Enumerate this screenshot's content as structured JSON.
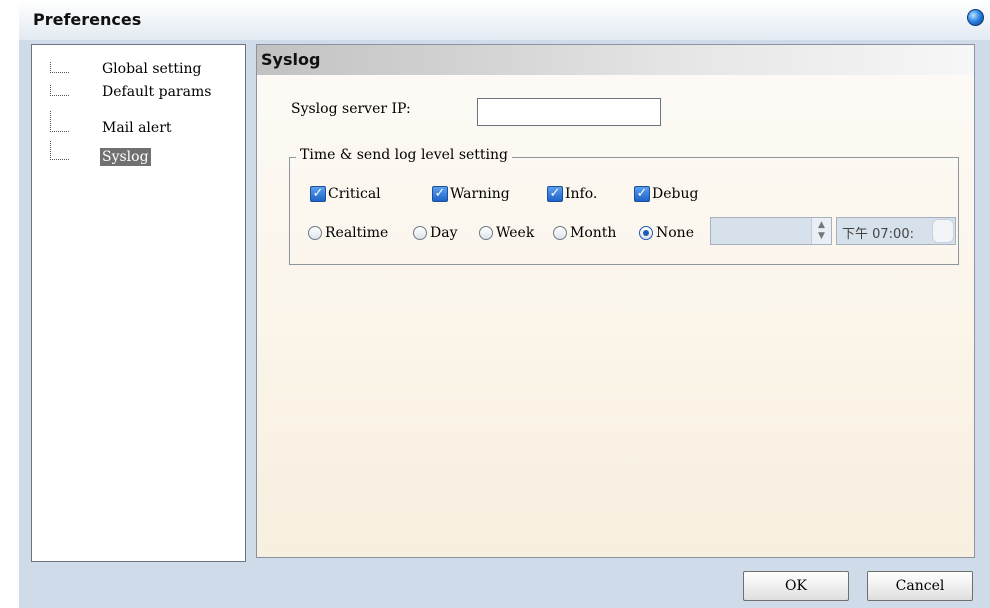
{
  "window": {
    "title": "Preferences"
  },
  "tree": {
    "items": [
      {
        "label": "Global setting",
        "selected": false
      },
      {
        "label": "Default params",
        "selected": false
      },
      {
        "label": "Mail alert",
        "selected": false
      },
      {
        "label": "Syslog",
        "selected": true
      }
    ]
  },
  "syslog": {
    "section_title": "Syslog",
    "server_ip_label": "Syslog server IP:",
    "server_ip_value": "",
    "group_legend": "Time & send log level setting",
    "levels": [
      {
        "label": "Critical",
        "checked": true
      },
      {
        "label": "Warning",
        "checked": true
      },
      {
        "label": "Info.",
        "checked": true
      },
      {
        "label": "Debug",
        "checked": true
      }
    ],
    "schedule": [
      {
        "label": "Realtime",
        "checked": false
      },
      {
        "label": "Day",
        "checked": false
      },
      {
        "label": "Week",
        "checked": false
      },
      {
        "label": "Month",
        "checked": false
      },
      {
        "label": "None",
        "checked": true
      }
    ],
    "date_value": "",
    "time_value": "下午 07:00:"
  },
  "buttons": {
    "ok": "OK",
    "cancel": "Cancel"
  },
  "colors": {
    "window_bg": "#cfdbe8",
    "accent": "#1e5bb5",
    "selected_bg": "#707070"
  }
}
